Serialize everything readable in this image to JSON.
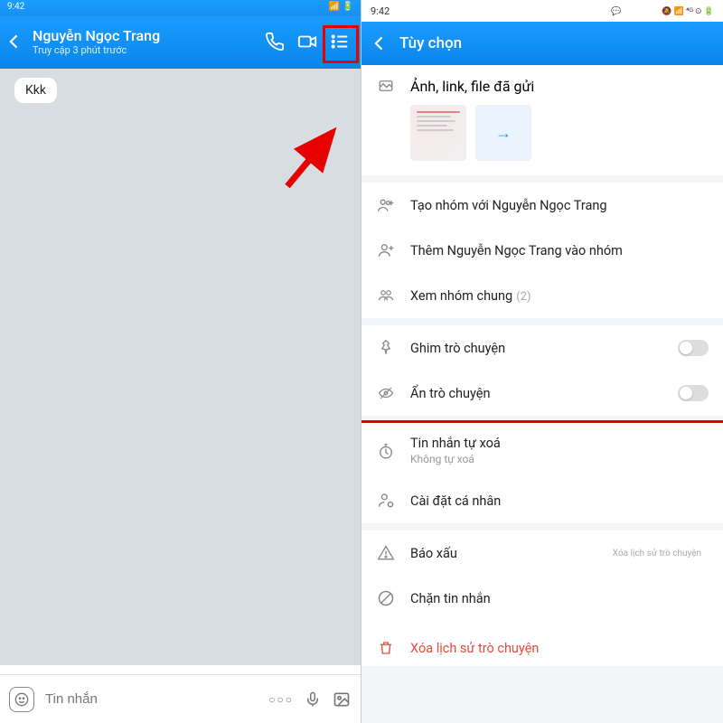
{
  "left": {
    "time": "9:42",
    "contact_name": "Nguyễn Ngọc Trang",
    "contact_status": "Truy cập 3 phút trước",
    "message": "Kkk",
    "input_placeholder": "Tin nhắn"
  },
  "right": {
    "time": "9:42",
    "status_icons": "🔕 📶 4G 🔋56",
    "title": "Tùy chọn",
    "media_label": "Ảnh, link, file đã gửi",
    "create_group": "Tạo nhóm với Nguyễn Ngọc Trang",
    "add_to_group": "Thêm Nguyễn Ngọc Trang vào nhóm",
    "view_groups": "Xem nhóm chung",
    "group_count": "(2)",
    "pin_chat": "Ghim trò chuyện",
    "hide_chat": "Ẩn trò chuyện",
    "auto_delete": "Tin nhắn tự xoá",
    "auto_delete_sub": "Không tự xoá",
    "personal_settings": "Cài đặt cá nhân",
    "report": "Báo xấu",
    "block": "Chặn tin nhắn",
    "delete_history": "Xóa lịch sử trò chuyện"
  }
}
